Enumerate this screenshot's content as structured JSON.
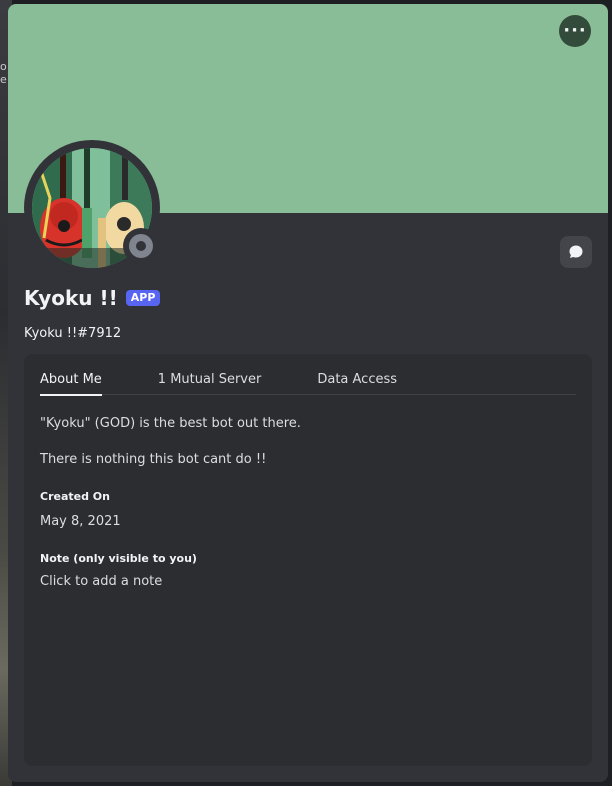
{
  "background": {
    "left_text": "o e"
  },
  "profile": {
    "banner_color": "#89bd97",
    "display_name": "Kyoku !!",
    "badge": "APP",
    "username": "Kyoku !!#7912",
    "status": "offline",
    "avatar_icon": "guitars-artwork",
    "more_icon": "more-horizontal-icon",
    "message_icon": "chat-bubble-icon"
  },
  "tabs": [
    {
      "label": "About Me",
      "active": true
    },
    {
      "label": "1 Mutual Server",
      "active": false
    },
    {
      "label": "Data Access",
      "active": false
    }
  ],
  "about": {
    "bio_line_1": "\"Kyoku\" (GOD) is the best bot out there.",
    "bio_line_2": "There is nothing this bot cant do !!",
    "created_title": "Created On",
    "created_value": "May 8, 2021",
    "note_title": "Note (only visible to you)",
    "note_placeholder": "Click to add a note"
  },
  "colors": {
    "card": "#313338",
    "inner_panel": "#2b2d31",
    "badge": "#5865f2",
    "status_offline": "#80848e"
  }
}
